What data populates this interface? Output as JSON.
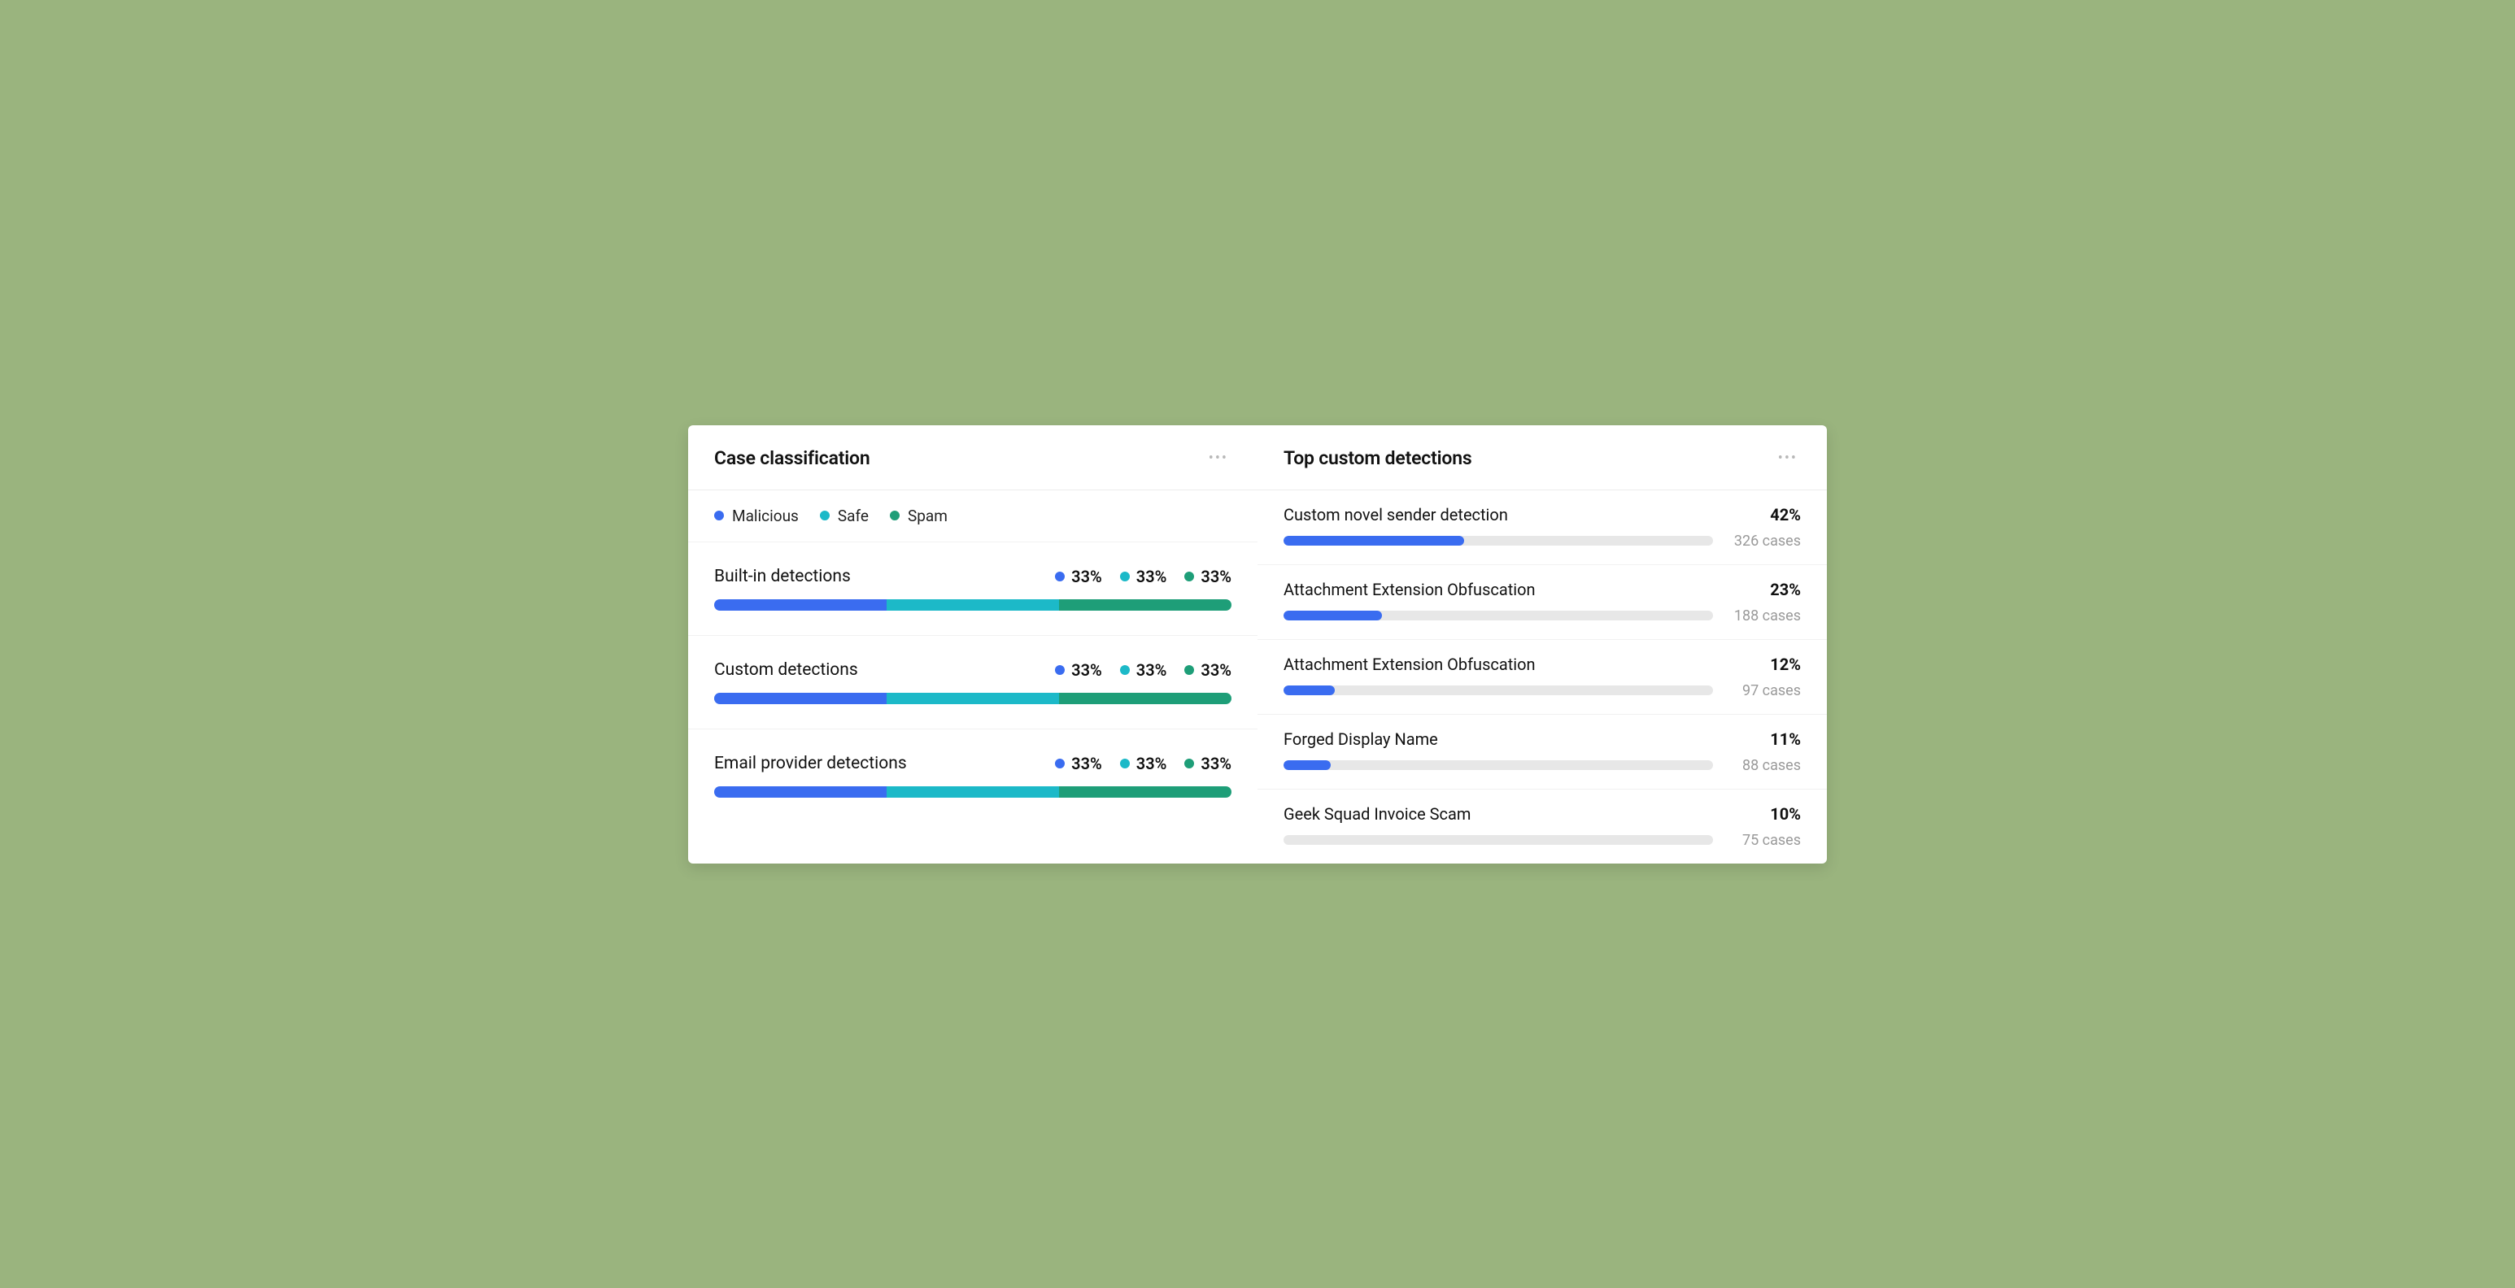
{
  "colors": {
    "malicious": "#3a6cf0",
    "safe": "#1cb9c8",
    "spam": "#1e9e78",
    "bar_fill": "#3a6cf0",
    "bar_track": "#e7e7e7"
  },
  "case_classification": {
    "title": "Case classification",
    "legend": [
      {
        "label": "Malicious",
        "color_key": "malicious"
      },
      {
        "label": "Safe",
        "color_key": "safe"
      },
      {
        "label": "Spam",
        "color_key": "spam"
      }
    ],
    "rows": [
      {
        "label": "Built-in detections",
        "malicious": "33%",
        "safe": "33%",
        "spam": "33%"
      },
      {
        "label": "Custom detections",
        "malicious": "33%",
        "safe": "33%",
        "spam": "33%"
      },
      {
        "label": "Email provider detections",
        "malicious": "33%",
        "safe": "33%",
        "spam": "33%"
      }
    ]
  },
  "top_custom_detections": {
    "title": "Top custom detections",
    "rows": [
      {
        "name": "Custom novel sender detection",
        "pct": "42%",
        "cases": "326 cases",
        "fill": 42
      },
      {
        "name": "Attachment Extension Obfuscation",
        "pct": "23%",
        "cases": "188 cases",
        "fill": 23
      },
      {
        "name": "Attachment Extension Obfuscation",
        "pct": "12%",
        "cases": "97 cases",
        "fill": 12
      },
      {
        "name": "Forged Display Name",
        "pct": "11%",
        "cases": "88 cases",
        "fill": 11
      },
      {
        "name": "Geek Squad Invoice Scam",
        "pct": "10%",
        "cases": "75 cases",
        "fill": 0
      }
    ]
  },
  "chart_data": [
    {
      "type": "bar",
      "title": "Case classification",
      "stacked": true,
      "categories": [
        "Built-in detections",
        "Custom detections",
        "Email provider detections"
      ],
      "series": [
        {
          "name": "Malicious",
          "values": [
            33,
            33,
            33
          ]
        },
        {
          "name": "Safe",
          "values": [
            33,
            33,
            33
          ]
        },
        {
          "name": "Spam",
          "values": [
            33,
            33,
            33
          ]
        }
      ],
      "xlabel": "",
      "ylabel": "%",
      "ylim": [
        0,
        100
      ]
    },
    {
      "type": "bar",
      "title": "Top custom detections",
      "categories": [
        "Custom novel sender detection",
        "Attachment Extension Obfuscation",
        "Attachment Extension Obfuscation",
        "Forged Display Name",
        "Geek Squad Invoice Scam"
      ],
      "values": [
        42,
        23,
        12,
        11,
        10
      ],
      "annotations": [
        "326 cases",
        "188 cases",
        "97 cases",
        "88 cases",
        "75 cases"
      ],
      "xlabel": "",
      "ylabel": "%",
      "ylim": [
        0,
        100
      ]
    }
  ]
}
